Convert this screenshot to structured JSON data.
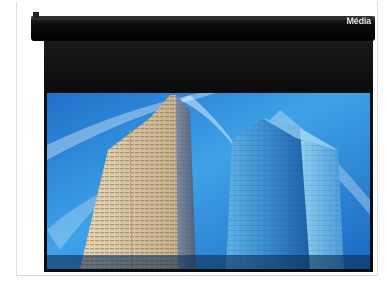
{
  "product": {
    "brand_label": "Média"
  }
}
